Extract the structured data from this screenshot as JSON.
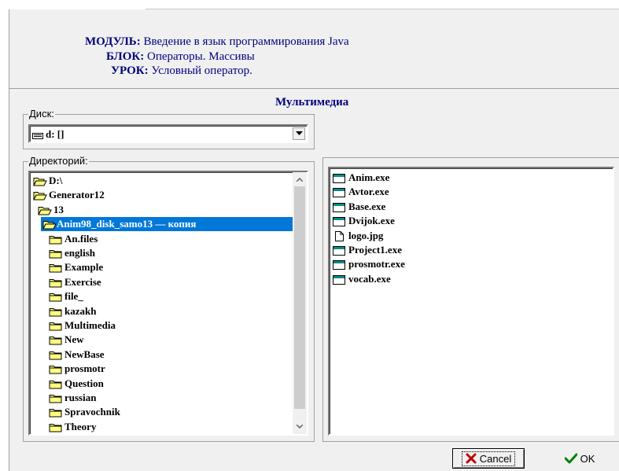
{
  "header": {
    "module_key": "МОДУЛЬ:",
    "module_value": "Введение в язык программирования Java",
    "block_key": "БЛОК:",
    "block_value": "Операторы. Массивы",
    "lesson_key": "УРОК:",
    "lesson_value": "Условный оператор."
  },
  "title": "Мультимедиа",
  "drive": {
    "label": "Диск:",
    "value": "d: []"
  },
  "directory": {
    "label": "Директорий:",
    "items": [
      {
        "label": "D:\\",
        "level": 0,
        "open": true,
        "selected": false
      },
      {
        "label": "Generator12",
        "level": 1,
        "open": true,
        "selected": false
      },
      {
        "label": "13",
        "level": 2,
        "open": true,
        "selected": false
      },
      {
        "label": "Anim98_disk_samo13 — копия",
        "level": 3,
        "open": true,
        "selected": true
      },
      {
        "label": "An.files",
        "level": 4,
        "open": false,
        "selected": false
      },
      {
        "label": "english",
        "level": 4,
        "open": false,
        "selected": false
      },
      {
        "label": "Example",
        "level": 4,
        "open": false,
        "selected": false
      },
      {
        "label": "Exercise",
        "level": 4,
        "open": false,
        "selected": false
      },
      {
        "label": "file_",
        "level": 4,
        "open": false,
        "selected": false
      },
      {
        "label": "kazakh",
        "level": 4,
        "open": false,
        "selected": false
      },
      {
        "label": "Multimedia",
        "level": 4,
        "open": false,
        "selected": false
      },
      {
        "label": "New",
        "level": 4,
        "open": false,
        "selected": false
      },
      {
        "label": "NewBase",
        "level": 4,
        "open": false,
        "selected": false
      },
      {
        "label": "prosmotr",
        "level": 4,
        "open": false,
        "selected": false
      },
      {
        "label": "Question",
        "level": 4,
        "open": false,
        "selected": false
      },
      {
        "label": "russian",
        "level": 4,
        "open": false,
        "selected": false
      },
      {
        "label": "Spravochnik",
        "level": 4,
        "open": false,
        "selected": false
      },
      {
        "label": "Theory",
        "level": 4,
        "open": false,
        "selected": false
      }
    ]
  },
  "files": [
    {
      "label": "Anim.exe",
      "kind": "exe"
    },
    {
      "label": "Avtor.exe",
      "kind": "exe"
    },
    {
      "label": "Base.exe",
      "kind": "exe"
    },
    {
      "label": "Dvijok.exe",
      "kind": "exe"
    },
    {
      "label": "logo.jpg",
      "kind": "doc"
    },
    {
      "label": "Project1.exe",
      "kind": "exe"
    },
    {
      "label": "prosmotr.exe",
      "kind": "exe"
    },
    {
      "label": "vocab.exe",
      "kind": "exe"
    }
  ],
  "buttons": {
    "cancel": "Cancel",
    "ok": "OK"
  },
  "colors": {
    "selection": "#0078d7",
    "header_text": "#000080",
    "folder_fill": "#ffff80"
  }
}
